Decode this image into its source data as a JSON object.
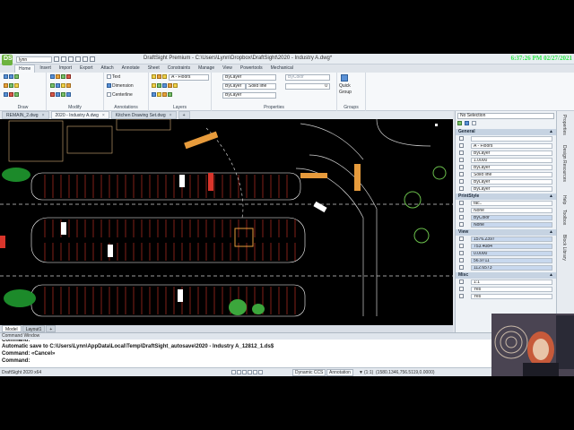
{
  "clock": "6:37:26 PM 02/27/2021",
  "titlebar": {
    "logo": "DS",
    "user": "lynn",
    "title": "DraftSight Premium - C:\\Users\\Lynn\\Dropbox\\DraftSight\\2020 - Industry A.dwg*"
  },
  "menu_tabs": [
    "Home",
    "Insert",
    "Import",
    "Export",
    "Attach",
    "Annotate",
    "Sheet",
    "Constraints",
    "Manage",
    "View",
    "Powertools",
    "Mechanical"
  ],
  "ribbon": {
    "groups": {
      "draw": "Draw",
      "modify": "Modify",
      "annotations": "Annotations",
      "layers": "Layers",
      "properties": "Properties",
      "groups": "Groups"
    },
    "annotations": {
      "text": "Text",
      "dimension": "Dimension",
      "centerline": "Centerline"
    },
    "layers": {
      "current": "A - Floors"
    },
    "properties": {
      "color1": "ByLayer",
      "color2": "ByColor",
      "lineweight": "ByLayer",
      "linestyle": "Solid line",
      "layer3": "ByLayer",
      "value": "0"
    },
    "groups_btn": {
      "quick_group_line1": "Quick",
      "quick_group_line2": "Group"
    }
  },
  "doc_tabs": [
    {
      "label": "REMAIN_2.dwg",
      "active": false
    },
    {
      "label": "2020 - Industry A.dwg",
      "active": true
    },
    {
      "label": "Kitchen Drawing Set.dwg",
      "active": false
    }
  ],
  "layout_tabs": [
    "Model",
    "Layout1",
    "+"
  ],
  "command_window": {
    "title": "Command Window",
    "lines": [
      "Command:",
      "Automatic save to C:\\Users\\Lynn\\AppData\\Local\\Temp\\DraftSight_autosave\\2020 - Industry A_12812_1.ds$",
      "Command: «Cancel»",
      "Command:"
    ]
  },
  "status_bar": {
    "version": "DraftSight 2020 x64",
    "dynamic_ccs": "Dynamic CCS",
    "annotation": "Annotation",
    "scale": "(1:1)",
    "coords": "(1580.1346,756.5119,0.0000)"
  },
  "properties_panel": {
    "selection": "No Selection",
    "sections": {
      "general": {
        "title": "General",
        "rows": [
          "",
          "A - Floors",
          "ByLayer",
          "1.0000",
          "ByLayer",
          "Solid line",
          "ByLayer",
          "ByLayer"
        ]
      },
      "print_style": {
        "title": "PrintStyle",
        "rows": [
          "fac..",
          "None",
          "ByColor",
          "None"
        ]
      },
      "view": {
        "title": "View",
        "rows": [
          "1576.2397",
          "753.4084",
          "0.0000",
          "56.9711",
          "112.6573"
        ]
      },
      "misc": {
        "title": "Misc",
        "rows": [
          "1:1",
          "Yes",
          "Yes"
        ]
      }
    }
  },
  "side_tabs": [
    "Properties",
    "Design Resources",
    "Help",
    "Toolbox",
    "Block Library"
  ],
  "colors": {
    "canvas": "#000000",
    "accent": "#2ee84a",
    "highlight": "#c8d8ee",
    "red_lines": "#d9352b",
    "section_header": "#c6d3e2"
  }
}
